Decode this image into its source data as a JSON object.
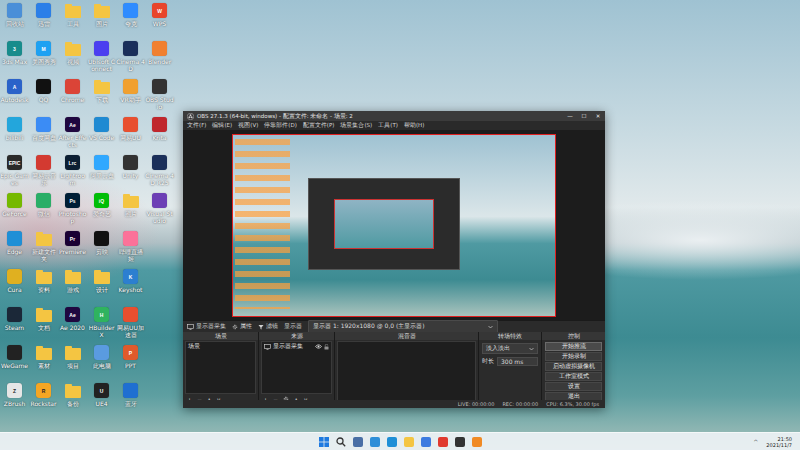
{
  "desktop_icons": [
    {
      "label": "回收站",
      "kind": "app",
      "color": "#4a8fd8",
      "glyph": ""
    },
    {
      "label": "3ds Max",
      "kind": "app",
      "color": "#178c8c",
      "glyph": "3"
    },
    {
      "label": "Autodesk",
      "kind": "app",
      "color": "#2a62c9",
      "glyph": "A"
    },
    {
      "label": "bilibili",
      "kind": "app",
      "color": "#23a6dc",
      "glyph": ""
    },
    {
      "label": "Epic Games",
      "kind": "app",
      "color": "#2a2a2a",
      "glyph": "EPIC"
    },
    {
      "label": "GeForce",
      "kind": "app",
      "color": "#76b900",
      "glyph": ""
    },
    {
      "label": "Edge",
      "kind": "app",
      "color": "#1f8fd6",
      "glyph": ""
    },
    {
      "label": "Cura",
      "kind": "app",
      "color": "#e0b020",
      "glyph": ""
    },
    {
      "label": "Steam",
      "kind": "app",
      "color": "#1b2838",
      "glyph": ""
    },
    {
      "label": "WeGame",
      "kind": "app",
      "color": "#222222",
      "glyph": ""
    },
    {
      "label": "ZBrush",
      "kind": "app",
      "color": "#e6e6e6",
      "glyph": "Z"
    },
    {
      "label": "迅雷",
      "kind": "app",
      "color": "#2b7fe8",
      "glyph": ""
    },
    {
      "label": "美图秀秀",
      "kind": "app",
      "color": "#1da1f2",
      "glyph": "M"
    },
    {
      "label": "QQ",
      "kind": "app",
      "color": "#111111",
      "glyph": ""
    },
    {
      "label": "百度网盘",
      "kind": "app",
      "color": "#3b8cf5",
      "glyph": ""
    },
    {
      "label": "网易云音乐",
      "kind": "app",
      "color": "#d33a31",
      "glyph": ""
    },
    {
      "label": "微信",
      "kind": "app",
      "color": "#2aae67",
      "glyph": ""
    },
    {
      "label": "新建文件夹",
      "kind": "folder",
      "color": "#f4c542",
      "glyph": ""
    },
    {
      "label": "资料",
      "kind": "folder",
      "color": "#f4c542",
      "glyph": ""
    },
    {
      "label": "文档",
      "kind": "folder",
      "color": "#f4c542",
      "glyph": ""
    },
    {
      "label": "素材",
      "kind": "folder",
      "color": "#f4c542",
      "glyph": ""
    },
    {
      "label": "Rockstar",
      "kind": "app",
      "color": "#f5a623",
      "glyph": "R"
    },
    {
      "label": "工具",
      "kind": "folder",
      "color": "#f4c542",
      "glyph": ""
    },
    {
      "label": "视频",
      "kind": "folder",
      "color": "#f4c542",
      "glyph": ""
    },
    {
      "label": "Chrome",
      "kind": "app",
      "color": "#db4437",
      "glyph": ""
    },
    {
      "label": "After Effects",
      "kind": "app",
      "color": "#1f0740",
      "glyph": "Ae"
    },
    {
      "label": "Lightroom",
      "kind": "app",
      "color": "#0c1f33",
      "glyph": "Lrc"
    },
    {
      "label": "Photoshop",
      "kind": "app",
      "color": "#001e36",
      "glyph": "Ps"
    },
    {
      "label": "Premiere",
      "kind": "app",
      "color": "#1a0033",
      "glyph": "Pr"
    },
    {
      "label": "游戏",
      "kind": "folder",
      "color": "#f4c542",
      "glyph": ""
    },
    {
      "label": "Ae 2020",
      "kind": "app",
      "color": "#1f0740",
      "glyph": "Ae"
    },
    {
      "label": "项目",
      "kind": "folder",
      "color": "#f4c542",
      "glyph": ""
    },
    {
      "label": "备份",
      "kind": "folder",
      "color": "#f4c542",
      "glyph": ""
    },
    {
      "label": "图片",
      "kind": "folder",
      "color": "#f4c542",
      "glyph": ""
    },
    {
      "label": "Ubisoft Connect",
      "kind": "app",
      "color": "#4b3ff0",
      "glyph": ""
    },
    {
      "label": "下载",
      "kind": "folder",
      "color": "#f4c542",
      "glyph": ""
    },
    {
      "label": "VS Code",
      "kind": "app",
      "color": "#1f8ad2",
      "glyph": ""
    },
    {
      "label": "阿里云盘",
      "kind": "app",
      "color": "#30a8ff",
      "glyph": ""
    },
    {
      "label": "爱奇艺",
      "kind": "app",
      "color": "#00be06",
      "glyph": "iQ"
    },
    {
      "label": "剪映",
      "kind": "app",
      "color": "#111111",
      "glyph": ""
    },
    {
      "label": "设计",
      "kind": "folder",
      "color": "#f4c542",
      "glyph": ""
    },
    {
      "label": "HBuilderX",
      "kind": "app",
      "color": "#2fb35f",
      "glyph": "H"
    },
    {
      "label": "此电脑",
      "kind": "app",
      "color": "#5a9be0",
      "glyph": ""
    },
    {
      "label": "UE4",
      "kind": "app",
      "color": "#222222",
      "glyph": "U"
    },
    {
      "label": "夸克",
      "kind": "app",
      "color": "#2f8cff",
      "glyph": ""
    },
    {
      "label": "Cinema 4D",
      "kind": "app",
      "color": "#1a2f5a",
      "glyph": ""
    },
    {
      "label": "VR助手",
      "kind": "app",
      "color": "#f0a030",
      "glyph": ""
    },
    {
      "label": "网易UU",
      "kind": "app",
      "color": "#e84f2f",
      "glyph": ""
    },
    {
      "label": "Unity",
      "kind": "app",
      "color": "#333333",
      "glyph": ""
    },
    {
      "label": "照片",
      "kind": "folder",
      "color": "#f4c542",
      "glyph": ""
    },
    {
      "label": "哔哩直播姬",
      "kind": "app",
      "color": "#fb7299",
      "glyph": ""
    },
    {
      "label": "Keyshot",
      "kind": "app",
      "color": "#2c7fd0",
      "glyph": "K"
    },
    {
      "label": "网易UU加速器",
      "kind": "app",
      "color": "#e84f2f",
      "glyph": ""
    },
    {
      "label": "PPT",
      "kind": "app",
      "color": "#e05a2b",
      "glyph": "P"
    },
    {
      "label": "蓝牙",
      "kind": "app",
      "color": "#1f6fd1",
      "glyph": ""
    },
    {
      "label": "WPS",
      "kind": "app",
      "color": "#e8452c",
      "glyph": "W"
    },
    {
      "label": "Blender",
      "kind": "app",
      "color": "#f08030",
      "glyph": ""
    },
    {
      "label": "OBS Studio",
      "kind": "app",
      "color": "#333333",
      "glyph": ""
    },
    {
      "label": "Krita",
      "kind": "app",
      "color": "#c0272d",
      "glyph": ""
    },
    {
      "label": "Cinema 4D R25",
      "kind": "app",
      "color": "#1a2f5a",
      "glyph": ""
    },
    {
      "label": "Visual Studio",
      "kind": "app",
      "color": "#6c3fb5",
      "glyph": ""
    }
  ],
  "obs": {
    "title": "OBS 27.1.3 (64-bit, windows) - 配置文件: 未命名 - 场景: 2",
    "window_controls": [
      "—",
      "☐",
      "✕"
    ],
    "menu": [
      "文件(F)",
      "编辑(E)",
      "视图(V)",
      "停靠部件(D)",
      "配置文件(P)",
      "场景集合(S)",
      "工具(T)",
      "帮助(H)"
    ],
    "source_bar": {
      "source": "显示器采集",
      "buttons": [
        "属性",
        "滤镜"
      ],
      "display_label": "显示器",
      "display_value": "显示器 1: 1920x1080 @ 0,0 (主显示器)"
    },
    "scenes": {
      "title": "场景",
      "items": [
        {
          "label": "场景",
          "selected": false
        }
      ]
    },
    "sources": {
      "title": "来源",
      "items": [
        {
          "label": "显示器采集",
          "visible": true,
          "locked": false,
          "selected": false
        }
      ]
    },
    "mixer": {
      "title": "混音器"
    },
    "transitions": {
      "title": "转场特效",
      "type": "淡入淡出",
      "duration_label": "时长",
      "duration": "300 ms"
    },
    "controls": {
      "title": "控制",
      "buttons": [
        {
          "label": "开始推流",
          "selected": true
        },
        {
          "label": "开始录制",
          "selected": false
        },
        {
          "label": "启动虚拟摄像机",
          "selected": false
        },
        {
          "label": "工作室模式",
          "selected": false
        },
        {
          "label": "设置",
          "selected": false
        },
        {
          "label": "退出",
          "selected": false
        }
      ]
    },
    "toolbar_glyphs": [
      "+",
      "−",
      "∧",
      "∨"
    ],
    "status": [
      "LIVE: 00:00:00",
      "REC: 00:00:00",
      "CPU: 6.3%, 30.00 fps"
    ]
  },
  "taskbar": {
    "icons": [
      {
        "kind": "start",
        "color": "#1f7ae0"
      },
      {
        "kind": "search",
        "color": "#333333"
      },
      {
        "kind": "app",
        "color": "#4a6fa5"
      },
      {
        "kind": "app",
        "color": "#2f8fd8"
      },
      {
        "kind": "app",
        "color": "#1f8fd6"
      },
      {
        "kind": "app",
        "color": "#f4c542"
      },
      {
        "kind": "app",
        "color": "#3d7be0"
      },
      {
        "kind": "app",
        "color": "#e03a2f"
      },
      {
        "kind": "app",
        "color": "#333333"
      },
      {
        "kind": "app",
        "color": "#f08a24"
      }
    ],
    "tray": "^",
    "time": "21:50",
    "date": "2021/11/7"
  }
}
